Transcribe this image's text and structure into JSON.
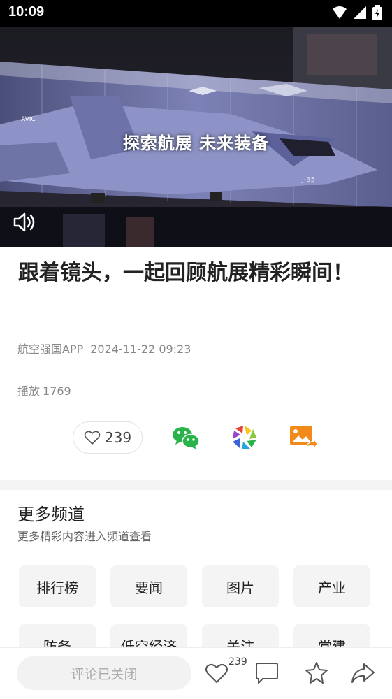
{
  "status": {
    "time": "10:09"
  },
  "video": {
    "caption": "探索航展  未来装备",
    "plane_marking": "J-35",
    "brand": "AVIC"
  },
  "article": {
    "title": "跟着镜头，一起回顾航展精彩瞬间！",
    "source": "航空强国APP",
    "datetime": "2024-11-22 09:23",
    "plays_label": "播放",
    "plays_count": "1769",
    "likes": "239"
  },
  "channels": {
    "title": "更多频道",
    "subtitle": "更多精彩内容进入频道查看",
    "items": [
      "排行榜",
      "要闻",
      "图片",
      "产业",
      "防务",
      "低空经济",
      "关注",
      "党建"
    ]
  },
  "bottom": {
    "comment_placeholder": "评论已关闭",
    "like_count": "239"
  },
  "colors": {
    "accent_green": "#2ab34a",
    "accent_orange": "#f28a1a"
  }
}
